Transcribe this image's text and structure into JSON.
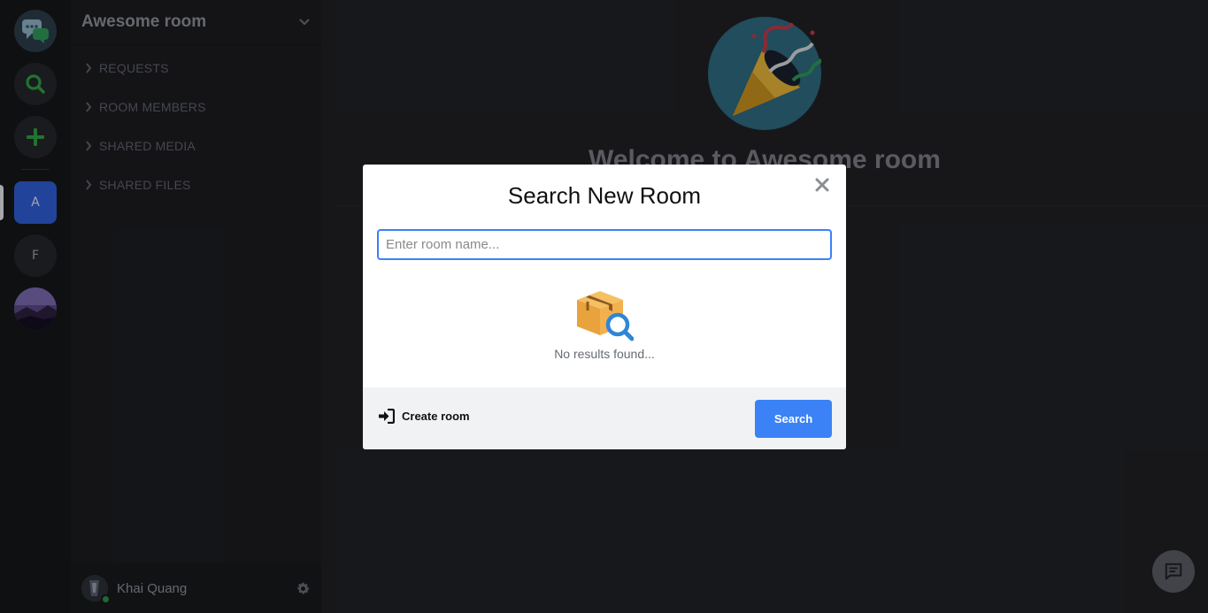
{
  "sidebar": {
    "room_title": "Awesome room",
    "sections": [
      {
        "label": "REQUESTS"
      },
      {
        "label": "ROOM MEMBERS"
      },
      {
        "label": "SHARED MEDIA"
      },
      {
        "label": "SHARED FILES"
      }
    ],
    "user": {
      "name": "Khai Quang"
    }
  },
  "rail": {
    "rooms": [
      {
        "initial": "A",
        "active": true
      },
      {
        "initial": "F",
        "active": false
      }
    ]
  },
  "main": {
    "welcome_title": "Welcome to Awesome room"
  },
  "modal": {
    "title": "Search New Room",
    "input_placeholder": "Enter room name...",
    "input_value": "",
    "empty_text": "No results found...",
    "create_label": "Create room",
    "search_label": "Search"
  },
  "colors": {
    "accent": "#3b82f6",
    "active_room": "#2f5fd6",
    "online": "#2e8f4a"
  }
}
